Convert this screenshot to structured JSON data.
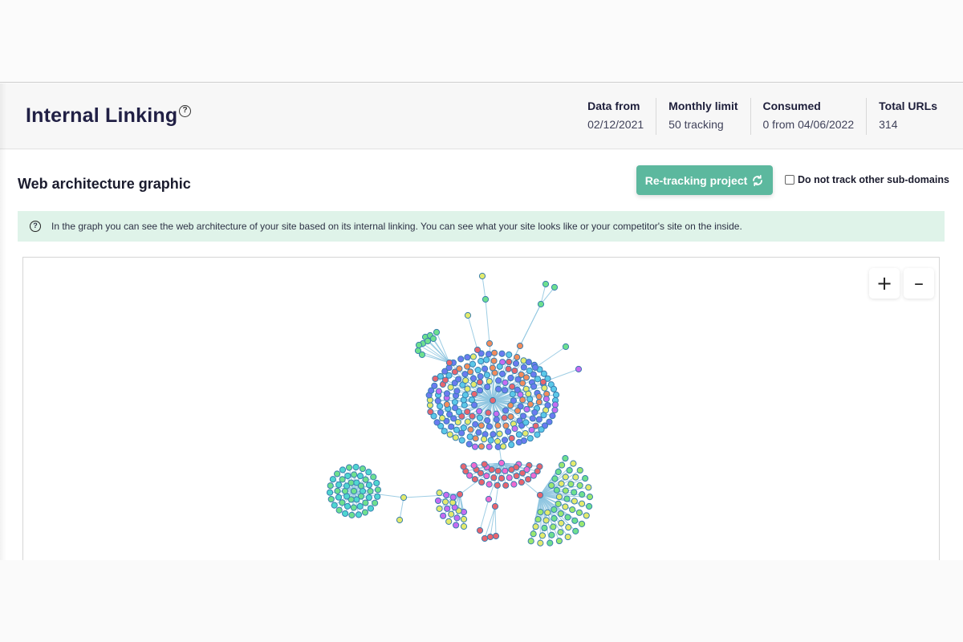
{
  "header": {
    "title": "Internal Linking",
    "help_icon": "question-circle-icon",
    "stats": [
      {
        "label": "Data from",
        "value": "02/12/2021"
      },
      {
        "label": "Monthly limit",
        "value": "50 tracking"
      },
      {
        "label": "Consumed",
        "value": "0 from 04/06/2022"
      },
      {
        "label": "Total URLs",
        "value": "314"
      }
    ]
  },
  "section": {
    "title": "Web architecture graphic",
    "retrack_label": "Re-tracking project",
    "retrack_icon": "refresh-icon",
    "checkbox_label": "Do not track other sub-domains",
    "checkbox_checked": false,
    "info_icon": "question-circle-icon",
    "info_text": "In the graph you can see the web architecture of your site based on its internal linking. You can see what your site looks like or your competitor's site on the inside."
  },
  "graph": {
    "zoom_in_label": "+",
    "zoom_out_label": "–",
    "node_colors": [
      "#6a7bf0",
      "#5bc8e8",
      "#f28c5c",
      "#e8656e",
      "#c66cf0",
      "#e3ea6c",
      "#6ee08e",
      "#4fd6d0",
      "#f06ad0",
      "#9ae870"
    ],
    "edge_color": "#8ec5e0",
    "node_stroke": "#3a7fb0",
    "total_nodes": 314
  }
}
